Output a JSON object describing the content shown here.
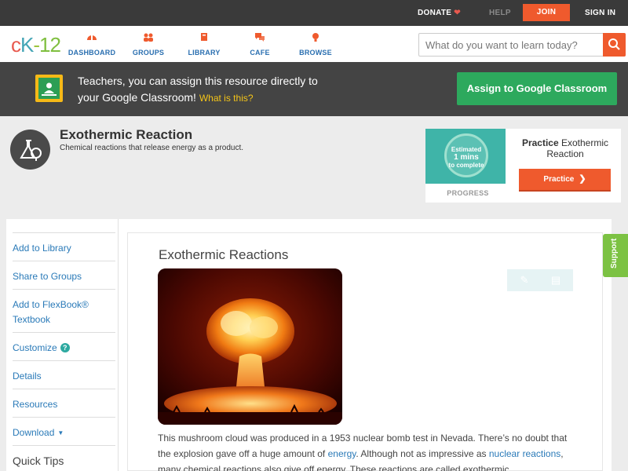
{
  "topbar": {
    "donate": "DONATE",
    "help": "HELP",
    "join": "JOIN",
    "signin": "SIGN IN"
  },
  "nav": {
    "logo": {
      "part1": "c",
      "part2": "K",
      "part3": "-",
      "part4": "12"
    },
    "items": [
      {
        "label": "DASHBOARD",
        "icon": "dashboard-icon"
      },
      {
        "label": "GROUPS",
        "icon": "groups-icon"
      },
      {
        "label": "LIBRARY",
        "icon": "library-icon"
      },
      {
        "label": "CAFE",
        "icon": "cafe-icon"
      },
      {
        "label": "BROWSE",
        "icon": "browse-icon"
      }
    ],
    "search_placeholder": "What do you want to learn today?"
  },
  "banner": {
    "line1": "Teachers, you can assign this resource directly to",
    "line2": "your Google Classroom!",
    "what": "What is this?",
    "assign_button": "Assign to Google Classroom"
  },
  "concept": {
    "title": "Exothermic Reaction",
    "subtitle": "Chemical reactions that release energy as a product."
  },
  "practice_card": {
    "estimate_line1": "Estimated",
    "estimate_line2": "1 mins",
    "estimate_line3": "to complete",
    "progress_label": "PROGRESS",
    "title_bold": "Practice",
    "title_rest": "Exothermic Reaction",
    "button": "Practice"
  },
  "sidebar": {
    "items": [
      {
        "label": "Add to Library"
      },
      {
        "label": "Share to Groups"
      },
      {
        "label": "Add to FlexBook®",
        "label2": "Textbook"
      },
      {
        "label": "Customize"
      },
      {
        "label": "Details"
      },
      {
        "label": "Resources"
      },
      {
        "label": "Download"
      }
    ],
    "quick_tips": "Quick Tips"
  },
  "article": {
    "title": "Exothermic Reactions",
    "p1_a": "This mushroom cloud was produced in a 1953 nuclear bomb test in Nevada. There’s no doubt",
    "p1_b": "that the explosion gave off a huge amount of ",
    "link_energy": "energy",
    "p1_c": ". Although not as impressive as ",
    "link_nuclear": "nuclear",
    "link_reactions": "reactions",
    "p1_d": ", many chemical reactions also give off energy. These reactions are called exothermic"
  },
  "support": "Support",
  "colors": {
    "accent_orange": "#ef5a2d",
    "google_green": "#2da95d",
    "link_blue": "#2a7ab8",
    "support_green": "#7cc243"
  }
}
